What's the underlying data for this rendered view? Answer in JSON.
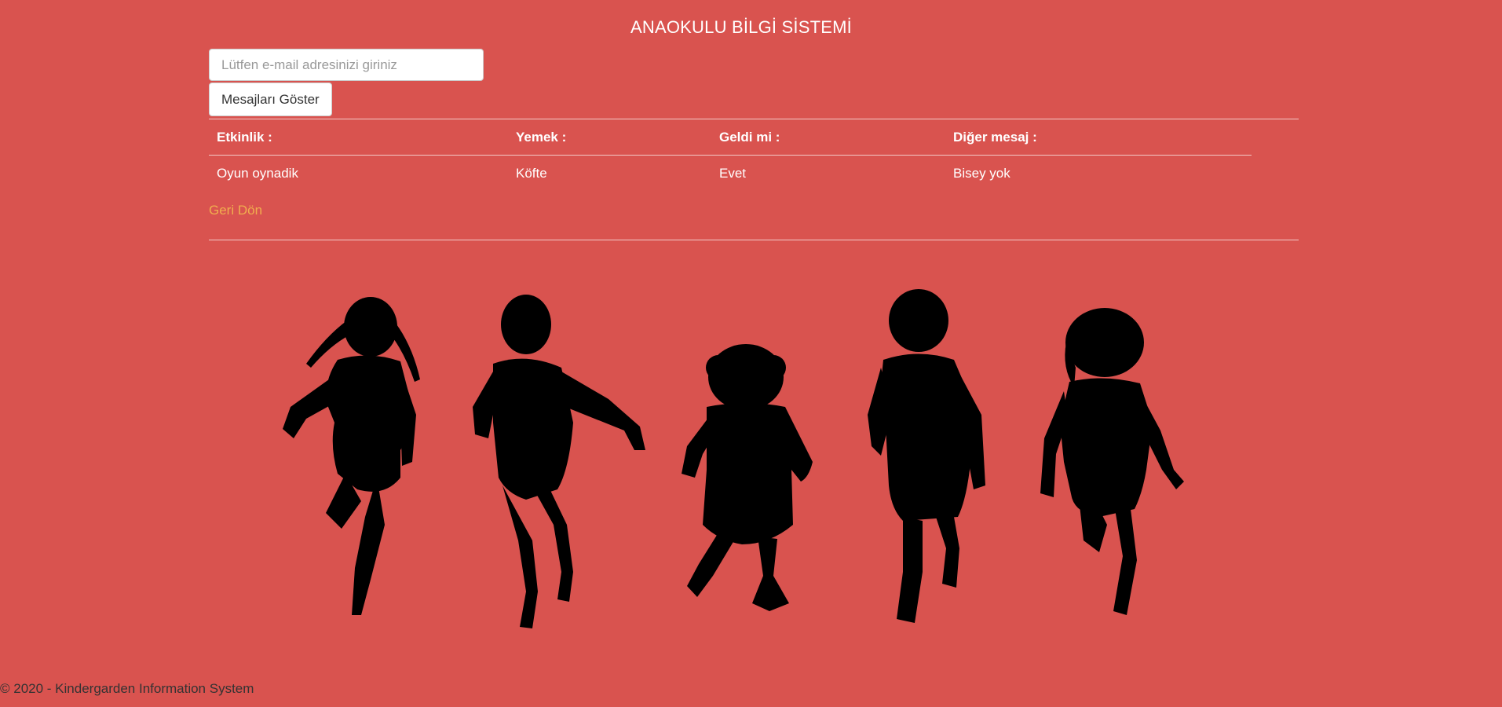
{
  "header": {
    "title": "ANAOKULU BİLGİ SİSTEMİ"
  },
  "form": {
    "email_placeholder": "Lütfen e-mail adresinizi giriniz",
    "email_value": "",
    "submit_label": "Mesajları Göster"
  },
  "table": {
    "headers": [
      "Etkinlik :",
      "Yemek :",
      "Geldi mi :",
      "Diğer mesaj :"
    ],
    "rows": [
      [
        "Oyun oynadik",
        "Köfte",
        "Evet",
        "Bisey yok"
      ]
    ]
  },
  "back_link": "Geri Dön",
  "image": {
    "subject": "silhouettes of five running children"
  },
  "footer": {
    "text": "© 2020 - Kindergarden Information System"
  },
  "colors": {
    "background": "#d9534f",
    "link": "#f0ad4e",
    "text": "#ffffff",
    "footer_text": "#333333"
  }
}
